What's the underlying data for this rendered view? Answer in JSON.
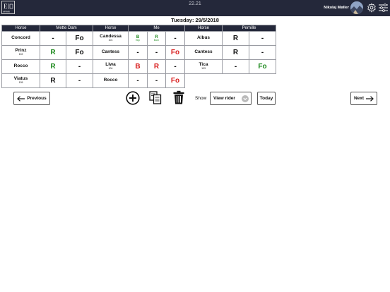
{
  "header": {
    "time": "22.21",
    "user_name": "Nikolaj Møller",
    "logo_text": "E  Rus  AFFAIR",
    "colors": {
      "bar": "#24283a",
      "green": "#1e8a1e",
      "red": "#d81a1a"
    }
  },
  "date_title": "Tuesday: 29/5/2018",
  "groups": [
    {
      "horse_header": "Horse",
      "rider_header": "Mette Dam",
      "rows": [
        {
          "horse": "Concord",
          "num": "",
          "marks": [
            {
              "text": "-",
              "color": "black"
            },
            {
              "text": "Fo",
              "color": "black"
            }
          ]
        },
        {
          "horse": "Prinz",
          "num": "102",
          "marks": [
            {
              "text": "R",
              "color": "green"
            },
            {
              "text": "Fo",
              "color": "black"
            }
          ]
        },
        {
          "horse": "Rocco",
          "num": "",
          "marks": [
            {
              "text": "R",
              "color": "green"
            },
            {
              "text": "-",
              "color": "black"
            }
          ]
        },
        {
          "horse": "Viatus",
          "num": "105",
          "marks": [
            {
              "text": "R",
              "color": "black"
            },
            {
              "text": "-",
              "color": "black"
            }
          ]
        }
      ]
    },
    {
      "horse_header": "Horse",
      "rider_header": "Me",
      "rows": [
        {
          "horse": "Candessa",
          "num": "101",
          "marks": [
            {
              "text": "B",
              "sub": "Klip",
              "color": "green"
            },
            {
              "text": "R",
              "sub": "Bom",
              "color": "green"
            },
            {
              "text": "-",
              "color": "black"
            }
          ]
        },
        {
          "horse": "Cantess",
          "num": "",
          "marks": [
            {
              "text": "-",
              "color": "black"
            },
            {
              "text": "-",
              "color": "black"
            },
            {
              "text": "Fo",
              "color": "red"
            }
          ]
        },
        {
          "horse": "Liwa",
          "num": "104",
          "marks": [
            {
              "text": "B",
              "color": "red"
            },
            {
              "text": "R",
              "color": "red"
            },
            {
              "text": "-",
              "color": "black"
            }
          ]
        },
        {
          "horse": "Rocco",
          "num": "",
          "marks": [
            {
              "text": "-",
              "color": "black"
            },
            {
              "text": "-",
              "color": "black"
            },
            {
              "text": "Fo",
              "color": "red"
            }
          ]
        }
      ]
    },
    {
      "horse_header": "Horse",
      "rider_header": "Pernille",
      "rows": [
        {
          "horse": "Albus",
          "num": "",
          "marks": [
            {
              "text": "R",
              "color": "black"
            },
            {
              "text": "-",
              "color": "black"
            }
          ]
        },
        {
          "horse": "Cantess",
          "num": "",
          "marks": [
            {
              "text": "R",
              "color": "black"
            },
            {
              "text": "-",
              "color": "black"
            }
          ]
        },
        {
          "horse": "Tica",
          "num": "103",
          "marks": [
            {
              "text": "-",
              "color": "black"
            },
            {
              "text": "Fo",
              "color": "green"
            }
          ]
        }
      ]
    }
  ],
  "toolbar": {
    "previous_label": "Previous",
    "next_label": "Next",
    "show_label": "Show",
    "view_select_value": "View rider",
    "today_label": "Today",
    "icons": [
      "add-icon",
      "copy-icon",
      "trash-icon"
    ]
  }
}
